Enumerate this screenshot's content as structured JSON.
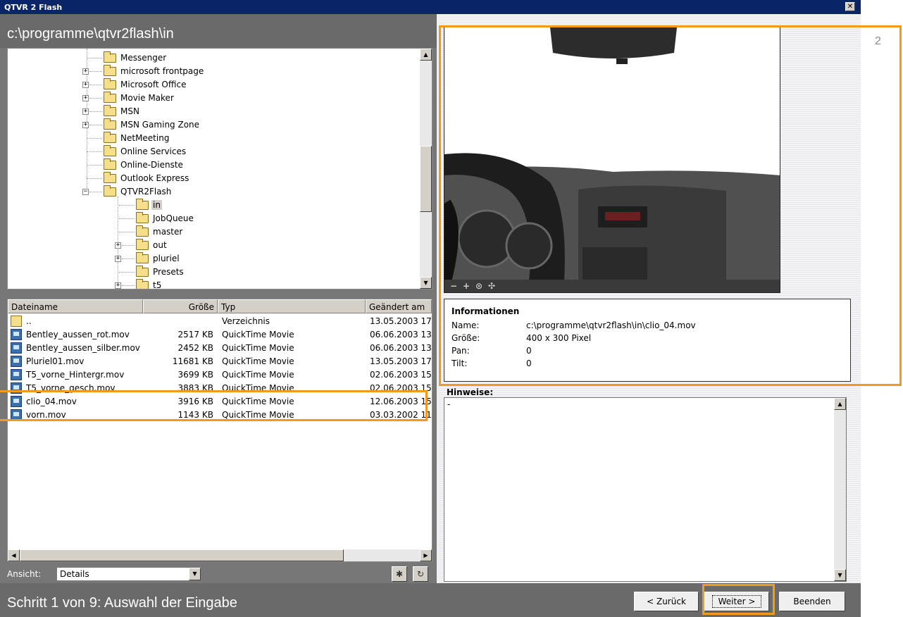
{
  "window": {
    "title": "QTVR 2 Flash",
    "close_glyph": "✕"
  },
  "path": "c:\\programme\\qtvr2flash\\in",
  "tree": [
    {
      "label": "Messenger"
    },
    {
      "label": "microsoft frontpage"
    },
    {
      "label": "Microsoft Office"
    },
    {
      "label": "Movie Maker"
    },
    {
      "label": "MSN"
    },
    {
      "label": "MSN Gaming Zone"
    },
    {
      "label": "NetMeeting"
    },
    {
      "label": "Online Services"
    },
    {
      "label": "Online-Dienste"
    },
    {
      "label": "Outlook Express"
    },
    {
      "label": "QTVR2Flash"
    },
    {
      "label": "in"
    },
    {
      "label": "JobQueue"
    },
    {
      "label": "master"
    },
    {
      "label": "out"
    },
    {
      "label": "pluriel"
    },
    {
      "label": "Presets"
    },
    {
      "label": "t5"
    }
  ],
  "filelist": {
    "columns": {
      "name": "Dateiname",
      "size": "Größe",
      "type": "Typ",
      "modified": "Geändert am"
    },
    "rows": [
      {
        "name": "..",
        "size": "",
        "type": "Verzeichnis",
        "modified": "13.05.2003 17"
      },
      {
        "name": "Bentley_aussen_rot.mov",
        "size": "2517 KB",
        "type": "QuickTime Movie",
        "modified": "06.06.2003 13"
      },
      {
        "name": "Bentley_aussen_silber.mov",
        "size": "2452 KB",
        "type": "QuickTime Movie",
        "modified": "06.06.2003 13"
      },
      {
        "name": "Pluriel01.mov",
        "size": "11681 KB",
        "type": "QuickTime Movie",
        "modified": "13.05.2003 17"
      },
      {
        "name": "T5_vorne_Hintergr.mov",
        "size": "3699 KB",
        "type": "QuickTime Movie",
        "modified": "02.06.2003 15"
      },
      {
        "name": "T5_vorne_gesch.mov",
        "size": "3883 KB",
        "type": "QuickTime Movie",
        "modified": "02.06.2003 15"
      },
      {
        "name": "clio_04.mov",
        "size": "3916 KB",
        "type": "QuickTime Movie",
        "modified": "12.06.2003 15"
      },
      {
        "name": "vorn.mov",
        "size": "1143 KB",
        "type": "QuickTime Movie",
        "modified": "03.03.2002 11"
      }
    ]
  },
  "view": {
    "label": "Ansicht:",
    "selected": "Details"
  },
  "info": {
    "heading": "Informationen",
    "name_label": "Name:",
    "name_value": "c:\\programme\\qtvr2flash\\in\\clio_04.mov",
    "size_label": "Größe:",
    "size_value": "400 x 300 Pixel",
    "pan_label": "Pan:",
    "pan_value": "0",
    "tilt_label": "Tilt:",
    "tilt_value": "0"
  },
  "notes": {
    "label": "Hinweise:",
    "text": "-"
  },
  "footer": {
    "step": "Schritt 1 von 9: Auswahl der Eingabe",
    "back": "< Zurück",
    "next": "Weiter >",
    "finish": "Beenden"
  },
  "annotation": {
    "number": "2",
    "color": "#f39a1d"
  }
}
